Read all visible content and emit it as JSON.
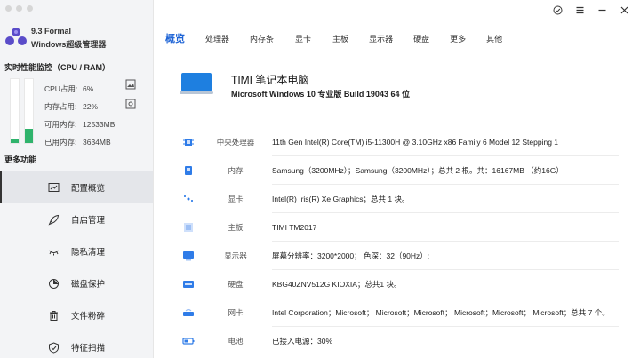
{
  "app": {
    "version": "9.3 Formal",
    "name": "Windows超级管理器"
  },
  "monitor": {
    "title": "实时性能监控（CPU / RAM）",
    "cpu_percent": 6,
    "ram_percent": 22,
    "stats": [
      {
        "label": "CPU占用:",
        "value": "6%"
      },
      {
        "label": "内存占用:",
        "value": "22%"
      },
      {
        "label": "可用内存:",
        "value": "12533MB"
      },
      {
        "label": "已用内存:",
        "value": "3634MB"
      }
    ]
  },
  "more": {
    "title": "更多功能",
    "items": [
      {
        "label": "配置概览",
        "icon": "chart-icon",
        "active": true
      },
      {
        "label": "自启管理",
        "icon": "rocket-icon",
        "active": false
      },
      {
        "label": "隐私清理",
        "icon": "eye-closed-icon",
        "active": false
      },
      {
        "label": "磁盘保护",
        "icon": "shield-icon",
        "active": false
      },
      {
        "label": "文件粉碎",
        "icon": "trash-icon",
        "active": false
      },
      {
        "label": "特征扫描",
        "icon": "shield-check-icon",
        "active": false
      }
    ]
  },
  "tabs": [
    "概览",
    "处理器",
    "内存条",
    "显卡",
    "主板",
    "显示器",
    "硬盘",
    "更多",
    "其他"
  ],
  "active_tab": 0,
  "device": {
    "title": "TIMI  笔记本电脑",
    "os": "Microsoft Windows 10 专业版 Build 19043 64 位"
  },
  "rows": [
    {
      "icon": "cpu-icon",
      "label": "中央处理器",
      "value": "11th Gen Intel(R) Core(TM) i5-11300H @ 3.10GHz x86 Family 6 Model 12 Stepping 1"
    },
    {
      "icon": "memory-icon",
      "label": "内存",
      "value": "Samsung（3200MHz）；Samsung（3200MHz）；总共 2 根。共：16167MB （约16G）"
    },
    {
      "icon": "gpu-icon",
      "label": "显卡",
      "value": "Intel(R) Iris(R) Xe Graphics；总共 1 块。"
    },
    {
      "icon": "motherboard-icon",
      "label": "主板",
      "value": "TIMI TM2017"
    },
    {
      "icon": "monitor-icon",
      "label": "显示器",
      "value": "屏幕分辨率：3200*2000；  色深：32（90Hz）;"
    },
    {
      "icon": "disk-icon",
      "label": "硬盘",
      "value": "KBG40ZNV512G KIOXIA；总共1 块。"
    },
    {
      "icon": "network-icon",
      "label": "网卡",
      "value": "Intel Corporation；Microsoft；  Microsoft；Microsoft；  Microsoft；Microsoft；  Microsoft；总共 7 个。"
    },
    {
      "icon": "battery-icon",
      "label": "电池",
      "value": "已接入电源：30%"
    }
  ],
  "colors": {
    "accent": "#1e64d6",
    "bar_fill": "#2fb36c",
    "sidebar_bg": "#f3f4f6"
  }
}
